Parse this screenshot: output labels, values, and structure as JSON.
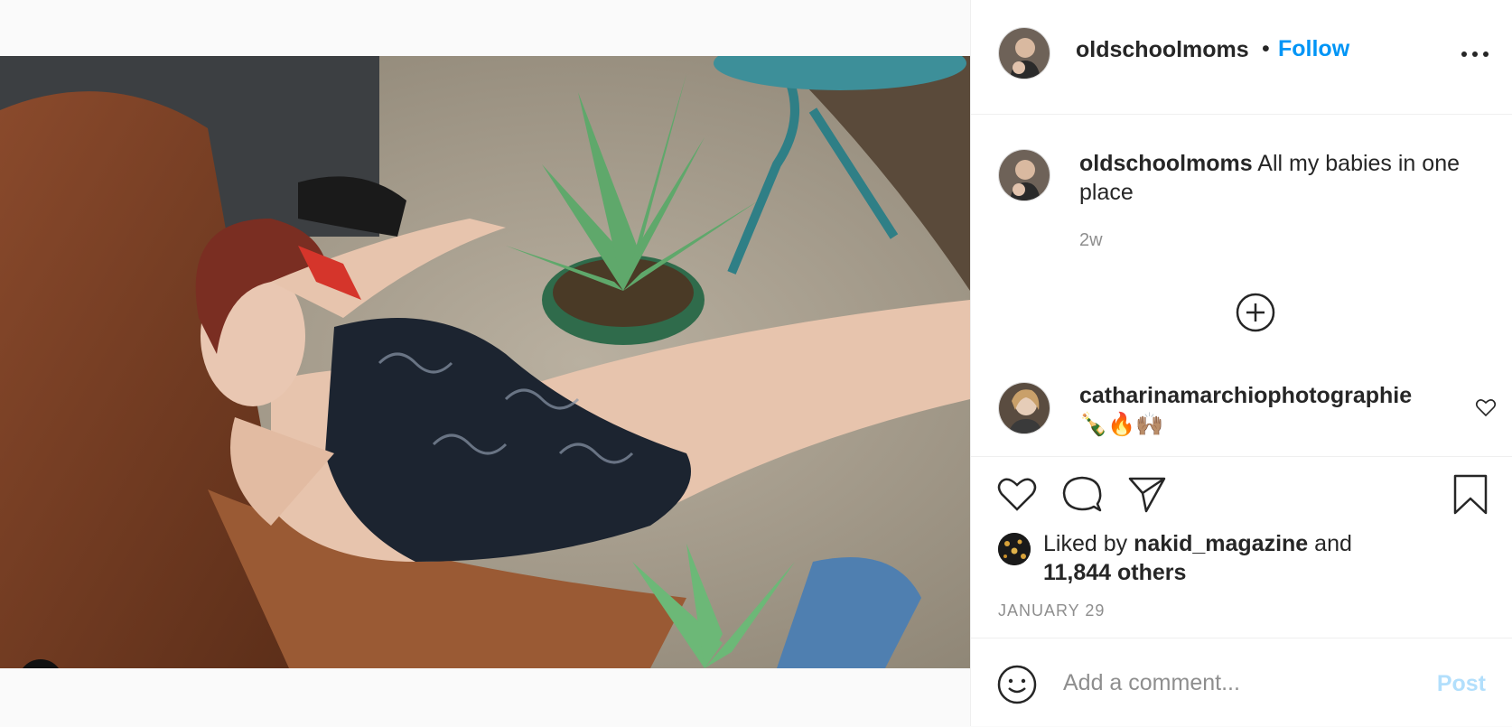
{
  "post": {
    "author": "oldschoolmoms",
    "follow_label": "Follow",
    "separator": "•",
    "caption": "All my babies in one place",
    "time_ago": "2w"
  },
  "comment": {
    "author": "catharinamarchiophotographie",
    "text": "🍾🔥🙌🏽"
  },
  "likes": {
    "prefix": "Liked by",
    "user": "nakid_magazine",
    "and": "and",
    "others": "11,844 others"
  },
  "date": "JANUARY 29",
  "comment_box": {
    "placeholder": "Add a comment...",
    "post_label": "Post"
  },
  "icons": {
    "more": "more-options-icon",
    "load_more": "load-more-comments-icon",
    "like": "heart-icon",
    "comment": "comment-bubble-icon",
    "share": "share-paper-plane-icon",
    "save": "bookmark-icon",
    "emoji": "emoji-icon",
    "tag": "user-tag-icon"
  },
  "colors": {
    "accent": "#0095f6",
    "post_disabled": "#b2dffc",
    "muted": "#8e8e8e"
  }
}
